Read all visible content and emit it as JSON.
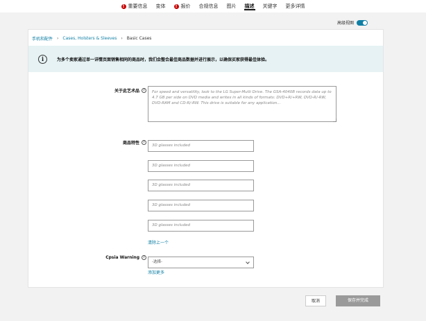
{
  "tabs": [
    {
      "label": "重要信息",
      "error": true
    },
    {
      "label": "变体",
      "error": false
    },
    {
      "label": "报价",
      "error": true
    },
    {
      "label": "合规信息",
      "error": false
    },
    {
      "label": "图片",
      "error": false
    },
    {
      "label": "描述",
      "error": false,
      "active": true
    },
    {
      "label": "关键字",
      "error": false
    },
    {
      "label": "更多详情",
      "error": false
    }
  ],
  "toggle": {
    "label": "高级视图",
    "on": true
  },
  "breadcrumb": [
    "手机和配件",
    "Cases, Holsters & Sleeves",
    "Basic Cases"
  ],
  "alert": {
    "icon": "i",
    "message": "为多个卖家通过单一详情页面销售相同的商品时，我们会整合最佳商品数据并进行展示，以确保买家获得最佳体验。"
  },
  "form": {
    "about_label": "关于此艺术品",
    "about_placeholder": "For speed and versatility, look to the LG Super-Multi Drive. The GSA-4040B records data up to 4.7 GB per side on DVD media and writes in all kinds of formats: DVD+R/+RW, DVD-R/-RW, DVD-RAM and CD-R/-RW. This drive is suitable for any application...",
    "features_label": "商品特性",
    "features_placeholders": [
      "3D glasses included",
      "3D glasses included",
      "3D glasses included",
      "3D glasses included",
      "3D glasses included"
    ],
    "remove_last": "清除上一个",
    "cpsia_label": "Cpsia Warning",
    "cpsia_value": "-选择-",
    "add_more": "添加更多"
  },
  "buttons": {
    "cancel": "取消",
    "save": "保存并完成"
  }
}
